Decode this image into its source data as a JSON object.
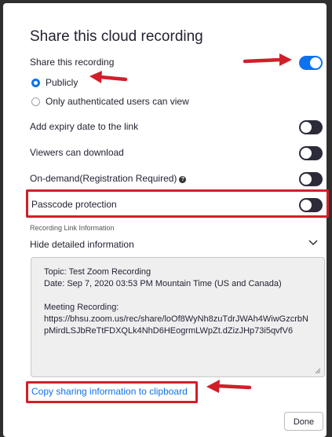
{
  "dialog": {
    "title": "Share this cloud recording",
    "share_label": "Share this recording",
    "share_toggle": true,
    "radio_publicly": "Publicly",
    "radio_authenticated": "Only authenticated users can view",
    "expiry_label": "Add expiry date to the link",
    "download_label": "Viewers can download",
    "ondemand_label": "On-demand(Registration Required)",
    "passcode_label": "Passcode protection",
    "section_header": "Recording Link Information",
    "hide_details": "Hide detailed information",
    "info": {
      "topic": "Topic: Test Zoom Recording",
      "date": "Date: Sep 7, 2020 03:53 PM Mountain Time (US and Canada)",
      "meeting_label": "Meeting Recording:",
      "url": "https://bhsu.zoom.us/rec/share/loOf8WyNh8zuTdrJWAh4WiwGzcrbNpMirdLSJbReTtFDXQLk4NhD6HEogrmLWpZt.dZizJHp73i5qvfV6"
    },
    "copy_link": "Copy sharing information to clipboard",
    "done": "Done"
  },
  "colors": {
    "accent": "#0e72ed",
    "highlight": "#d11f2a",
    "toggle_off": "#2b2b3a"
  }
}
